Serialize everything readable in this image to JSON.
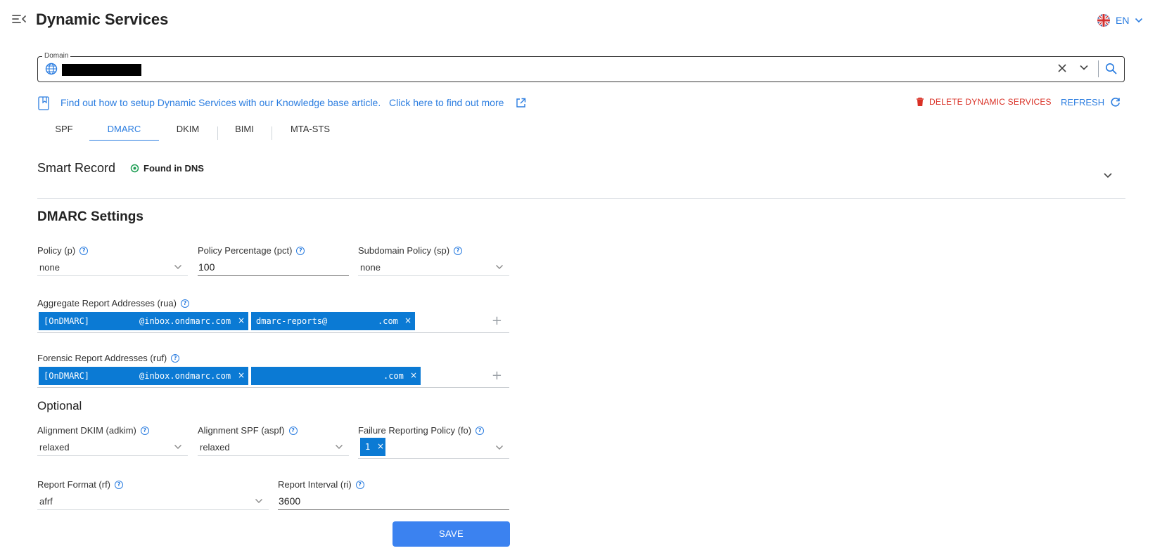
{
  "header": {
    "title": "Dynamic Services",
    "language": "EN"
  },
  "domain": {
    "label": "Domain",
    "value": ""
  },
  "info": {
    "kb_text": "Find out how to setup Dynamic Services with our Knowledge base article.",
    "kb_link": "Click here to find out more",
    "delete_label": "DELETE DYNAMIC SERVICES",
    "refresh_label": "REFRESH"
  },
  "tabs": [
    {
      "label": "SPF",
      "active": false
    },
    {
      "label": "DMARC",
      "active": true
    },
    {
      "label": "DKIM",
      "active": false
    },
    {
      "label": "BIMI",
      "active": false
    },
    {
      "label": "MTA-STS",
      "active": false
    }
  ],
  "smart_record": {
    "title": "Smart Record",
    "status": "Found in DNS"
  },
  "settings": {
    "title": "DMARC Settings",
    "policy": {
      "label": "Policy (p)",
      "value": "none"
    },
    "pct": {
      "label": "Policy Percentage (pct)",
      "value": "100"
    },
    "sp": {
      "label": "Subdomain Policy (sp)",
      "value": "none"
    },
    "rua": {
      "label": "Aggregate Report Addresses (rua)",
      "chips": [
        {
          "prefix": "[OnDMARC]",
          "suffix": "@inbox.ondmarc.com"
        },
        {
          "prefix": "dmarc-reports@",
          "suffix": ".com"
        }
      ]
    },
    "ruf": {
      "label": "Forensic Report Addresses (ruf)",
      "chips": [
        {
          "prefix": "[OnDMARC]",
          "suffix": "@inbox.ondmarc.com"
        },
        {
          "prefix": "",
          "suffix": ".com"
        }
      ]
    }
  },
  "optional": {
    "title": "Optional",
    "adkim": {
      "label": "Alignment DKIM (adkim)",
      "value": "relaxed"
    },
    "aspf": {
      "label": "Alignment SPF (aspf)",
      "value": "relaxed"
    },
    "fo": {
      "label": "Failure Reporting Policy (fo)",
      "chip": "1"
    },
    "rf": {
      "label": "Report Format (rf)",
      "value": "afrf"
    },
    "ri": {
      "label": "Report Interval (ri)",
      "value": "3600"
    }
  },
  "save_label": "SAVE",
  "colors": {
    "accent": "#2b7de0",
    "chip": "#0b7ad4",
    "danger": "#d93025",
    "success": "#1e9e54",
    "button": "#3b82f0"
  },
  "icons": [
    "menu-collapse-icon",
    "uk-flag-icon",
    "chevron-down-icon",
    "globe-icon",
    "close-icon",
    "search-icon",
    "bookmark-icon",
    "external-link-icon",
    "trash-icon",
    "refresh-icon",
    "target-icon",
    "help-icon",
    "plus-icon"
  ]
}
